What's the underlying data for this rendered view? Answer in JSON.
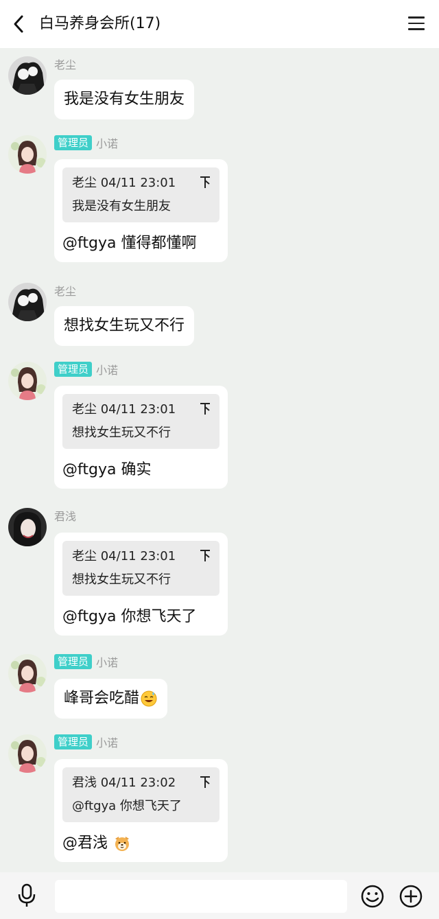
{
  "header": {
    "title": "白马养身会所(17)"
  },
  "messages": [
    {
      "sender": "老尘",
      "text": "我是没有女生朋友"
    },
    {
      "badge": "管理员",
      "sender": "小诺",
      "quote_head": "老尘 04/11 23:01",
      "quote_body": "我是没有女生朋友",
      "text": "@ftgya 懂得都懂啊"
    },
    {
      "sender": "老尘",
      "text": "想找女生玩又不行"
    },
    {
      "badge": "管理员",
      "sender": "小诺",
      "quote_head": "老尘 04/11 23:01",
      "quote_body": "想找女生玩又不行",
      "text": "@ftgya 确实"
    },
    {
      "sender": "君浅",
      "quote_head": "老尘 04/11 23:01",
      "quote_body": "想找女生玩又不行",
      "text": "@ftgya 你想飞天了"
    },
    {
      "badge": "管理员",
      "sender": "小诺",
      "text": "峰哥会吃醋",
      "emoji": "grinning-sweat-emoji"
    },
    {
      "badge": "管理员",
      "sender": "小诺",
      "quote_head": "君浅 04/11 23:02",
      "quote_body": "@ftgya 你想飞天了",
      "text": "@君浅",
      "emoji": "dog-face-emoji"
    }
  ],
  "input_bar": {
    "placeholder": "",
    "icons": [
      "microphone-icon",
      "emoji-icon",
      "plus-icon"
    ]
  },
  "colors": {
    "background": "#eef1ee",
    "admin_badge": "#3fcfc9",
    "bubble": "#ffffff",
    "quote_block": "#ebebeb"
  }
}
